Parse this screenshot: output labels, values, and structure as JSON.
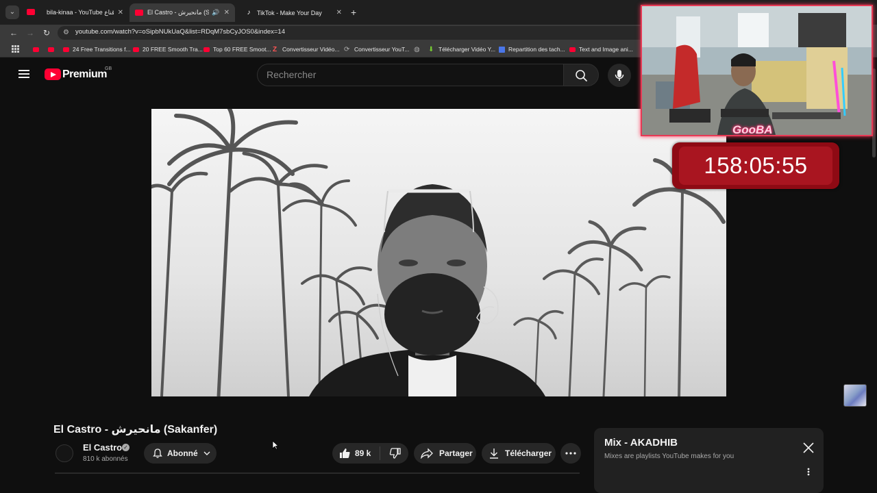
{
  "browser": {
    "tabs": [
      {
        "label": "bila-kinaa - YouTube بلا قناع",
        "close": "✕"
      },
      {
        "label": "El Castro - مانحيرش (Sakanfer)",
        "close": "✕"
      },
      {
        "label": "TikTok - Make Your Day",
        "close": "✕"
      }
    ],
    "new_tab": "+",
    "tab_menu": "⌄",
    "url": "youtube.com/watch?v=oSipbNUkUaQ&list=RDqM7sbCyJOS0&index=14",
    "bookmarks": [
      {
        "label": "24 Free Transitions f..."
      },
      {
        "label": "20 FREE Smooth Tra..."
      },
      {
        "label": "Top 60 FREE Smoot..."
      },
      {
        "label": "Convertisseur Vidéo..."
      },
      {
        "label": "Convertisseur YouT..."
      },
      {
        "label": "Télécharger Vidéo Y..."
      },
      {
        "label": "Repartition des tach..."
      },
      {
        "label": "Text and Image ani..."
      }
    ]
  },
  "youtube": {
    "logo_text": "Premium",
    "region": "GB",
    "search_placeholder": "Rechercher",
    "video": {
      "title": "El Castro - مانحيرش (Sakanfer)",
      "channel": "El Castro",
      "subscribers": "810 k abonnés",
      "subscribe_label": "Abonné",
      "likes": "89 k",
      "share_label": "Partager",
      "download_label": "Télécharger"
    },
    "mix": {
      "title": "Mix - AKADHIB",
      "subtitle": "Mixes are playlists YouTube makes for you"
    }
  },
  "overlay": {
    "timer": "158:05:55",
    "streamer_tag": "GooBA"
  },
  "colors": {
    "yt_red": "#ff0033",
    "timer_bg": "#a91520",
    "webcam_border": "#e63a55"
  }
}
